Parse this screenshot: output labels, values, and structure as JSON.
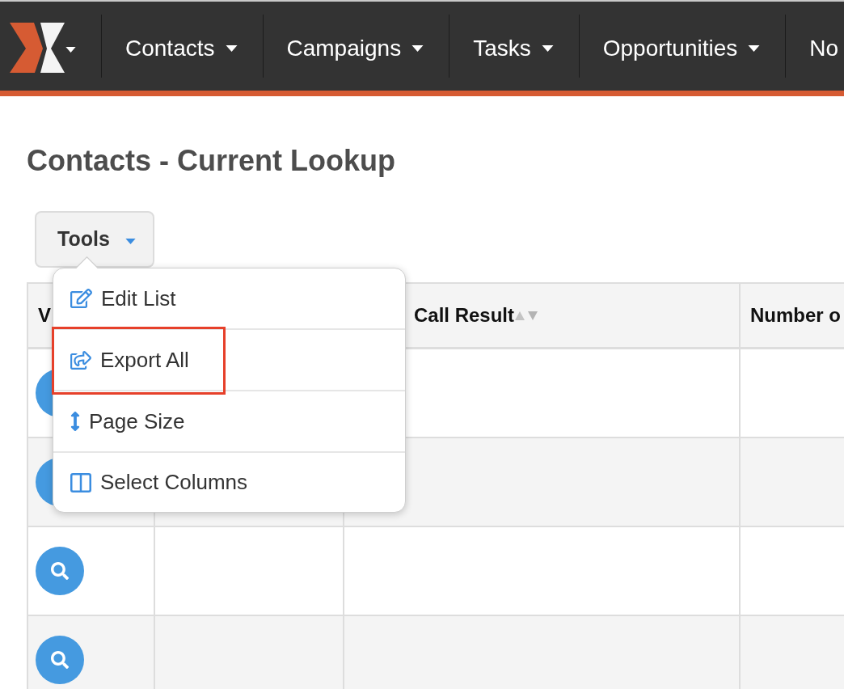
{
  "navbar": {
    "brand": {
      "dropdown": true
    },
    "items": [
      {
        "label": "Contacts",
        "dropdown": true
      },
      {
        "label": "Campaigns",
        "dropdown": true
      },
      {
        "label": "Tasks",
        "dropdown": true
      },
      {
        "label": "Opportunities",
        "dropdown": true
      },
      {
        "label": "No"
      }
    ]
  },
  "page_title": "Contacts - Current Lookup",
  "tools": {
    "label": "Tools",
    "expanded": true,
    "menu": [
      {
        "label": "Edit List",
        "highlighted": false
      },
      {
        "label": "Export All",
        "highlighted": true
      },
      {
        "label": "Page Size",
        "highlighted": false
      },
      {
        "label": "Select Columns",
        "highlighted": false
      }
    ]
  },
  "table": {
    "columns": [
      {
        "label": "V"
      },
      {
        "label": "Call Result",
        "sortable": true
      },
      {
        "label": "Number o"
      }
    ],
    "rows": [
      {
        "kind": "view"
      },
      {
        "kind": "view"
      },
      {
        "kind": "view"
      },
      {
        "kind": "view"
      }
    ]
  }
}
